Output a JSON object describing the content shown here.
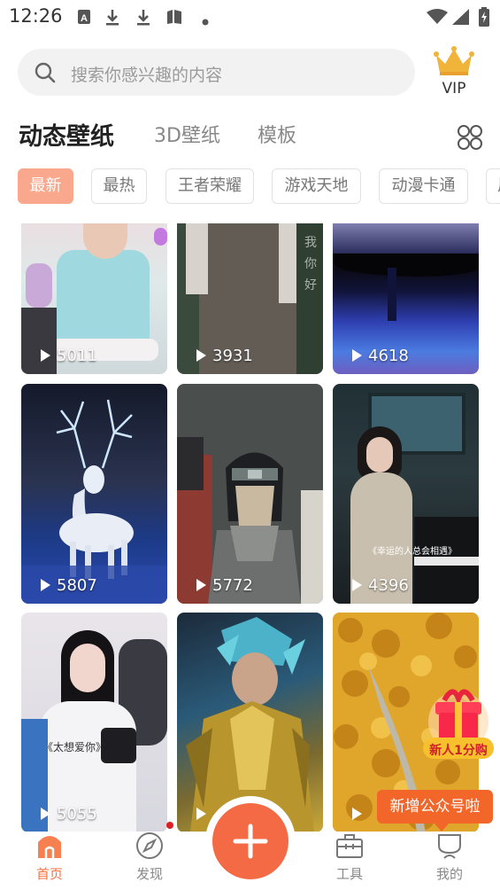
{
  "status_bar": {
    "time": "12:26",
    "left_icons": [
      "a-icon",
      "download-icon",
      "download-icon",
      "book-icon",
      "dot-icon"
    ],
    "right_icons": [
      "wifi-icon",
      "signal-icon",
      "battery-charging-icon"
    ]
  },
  "search": {
    "placeholder": "搜索你感兴趣的内容",
    "icon": "search-icon"
  },
  "vip": {
    "label": "VIP",
    "icon": "crown-icon"
  },
  "tabs": [
    {
      "label": "动态壁纸",
      "active": true
    },
    {
      "label": "3D壁纸",
      "active": false
    },
    {
      "label": "模板",
      "active": false
    }
  ],
  "chips": [
    {
      "label": "最新",
      "active": true
    },
    {
      "label": "最热",
      "active": false
    },
    {
      "label": "王者荣耀",
      "active": false
    },
    {
      "label": "游戏天地",
      "active": false
    },
    {
      "label": "动漫卡通",
      "active": false
    },
    {
      "label": "风",
      "active": false
    }
  ],
  "wallpapers": [
    {
      "views": "5011"
    },
    {
      "views": "3931"
    },
    {
      "views": "4618"
    },
    {
      "views": "5807"
    },
    {
      "views": "5772"
    },
    {
      "views": "4396"
    },
    {
      "views": "5055"
    },
    {
      "views": ""
    },
    {
      "views": ""
    }
  ],
  "overlay_text": {
    "pianist_caption": "《幸运的人总会相遇》",
    "hoodie_caption": "《太想爱你》",
    "gift_badge": "新人1分购"
  },
  "toast": {
    "text": "新增公众号啦"
  },
  "bottom_nav": [
    {
      "label": "首页",
      "icon": "home-icon",
      "active": true
    },
    {
      "label": "发现",
      "icon": "compass-icon",
      "active": false
    },
    {
      "label": "工具",
      "icon": "toolbox-icon",
      "active": false
    },
    {
      "label": "我的",
      "icon": "user-icon",
      "active": false
    }
  ],
  "colors": {
    "accent": "#f46a45",
    "chip_active": "#f9a88d",
    "toast": "#f2662a",
    "notification_dot": "#e02020"
  }
}
